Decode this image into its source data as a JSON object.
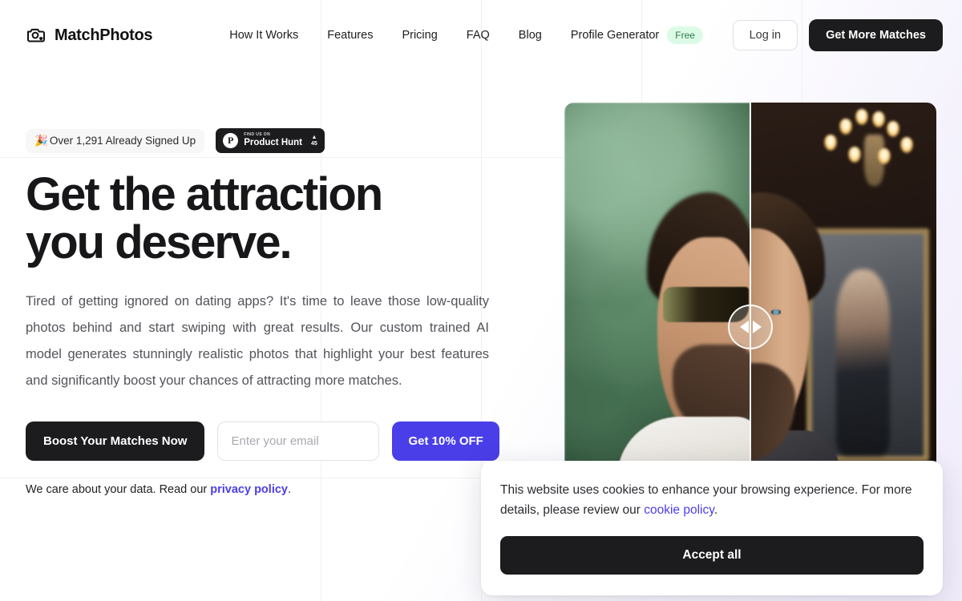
{
  "brand": {
    "name": "MatchPhotos",
    "icon": "camera-heart-icon"
  },
  "nav": {
    "links": [
      {
        "label": "How It Works"
      },
      {
        "label": "Features"
      },
      {
        "label": "Pricing"
      },
      {
        "label": "FAQ"
      },
      {
        "label": "Blog"
      }
    ],
    "profile_generator": {
      "label": "Profile Generator",
      "badge": "Free"
    },
    "login_label": "Log in",
    "cta_label": "Get More Matches"
  },
  "hero": {
    "signup_badge": {
      "emoji": "🎉",
      "text": "Over 1,291 Already Signed Up"
    },
    "product_hunt": {
      "kicker": "FIND US ON",
      "name": "Product Hunt",
      "arrow": "▲",
      "votes": "45",
      "logo_letter": "P"
    },
    "headline_line1": "Get the attraction",
    "headline_line2": "you deserve.",
    "subcopy": "Tired of getting ignored on dating apps? It's time to leave those low-quality photos behind and start swiping with great results. Our custom trained AI model generates stunningly realistic photos that highlight your best features and significantly boost your chances of attracting more matches.",
    "boost_label": "Boost Your Matches Now",
    "email_placeholder": "Enter your email",
    "email_value": "",
    "discount_label": "Get 10% OFF",
    "privacy_prefix": "We care about your data. Read our ",
    "privacy_link": "privacy policy",
    "privacy_suffix": "."
  },
  "media": {
    "comparison_slider": "before-after-image-comparison",
    "before_alt": "man with sunglasses in front of green foliage",
    "after_alt": "AI studio portrait with chandelier and framed painting"
  },
  "cookie": {
    "text_prefix": "This website uses cookies to enhance your browsing experience. For more details, please review our ",
    "link": "cookie policy",
    "text_suffix": ".",
    "accept_label": "Accept all"
  },
  "colors": {
    "accent": "#4a3ee8",
    "dark": "#1c1c1e",
    "free_badge_bg": "#dcfbe6",
    "free_badge_text": "#2f7a4b"
  }
}
